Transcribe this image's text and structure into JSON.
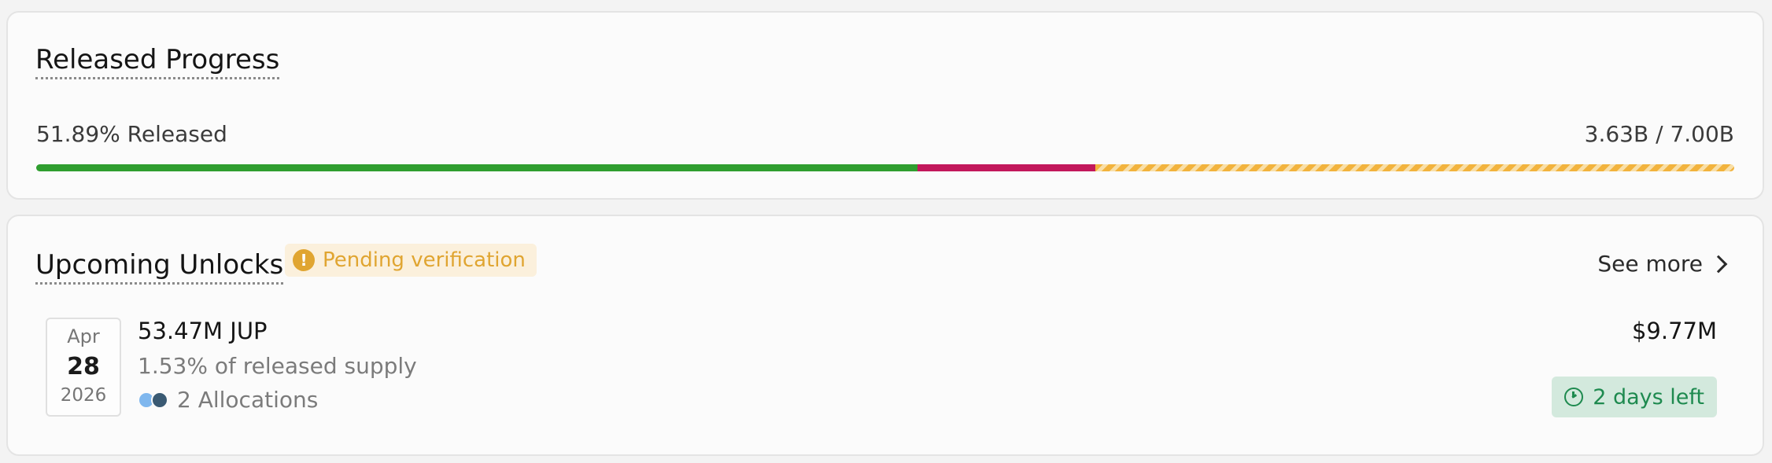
{
  "released": {
    "title": "Released Progress",
    "percent_label": "51.89% Released",
    "amount_label": "3.63B / 7.00B",
    "bar": {
      "released_fraction": 0.5189,
      "second_segment_fraction": 0.1046,
      "colors": {
        "released": "#2f9e2f",
        "second": "#c2185b",
        "remaining": "#f2b33d"
      }
    }
  },
  "upcoming": {
    "title": "Upcoming Unlocks",
    "badge": {
      "icon": "warning-icon",
      "label": "Pending verification",
      "color": "#e0a531"
    },
    "see_more_label": "See more",
    "items": [
      {
        "date": {
          "month": "Apr",
          "day": "28",
          "year": "2026"
        },
        "amount": "53.47M JUP",
        "supply_text": "1.53% of released supply",
        "allocations": "2 Allocations",
        "value": "$9.77M",
        "time_left": {
          "icon": "clock-icon",
          "label": "2 days left",
          "color": "#1e8a4f"
        }
      }
    ]
  }
}
